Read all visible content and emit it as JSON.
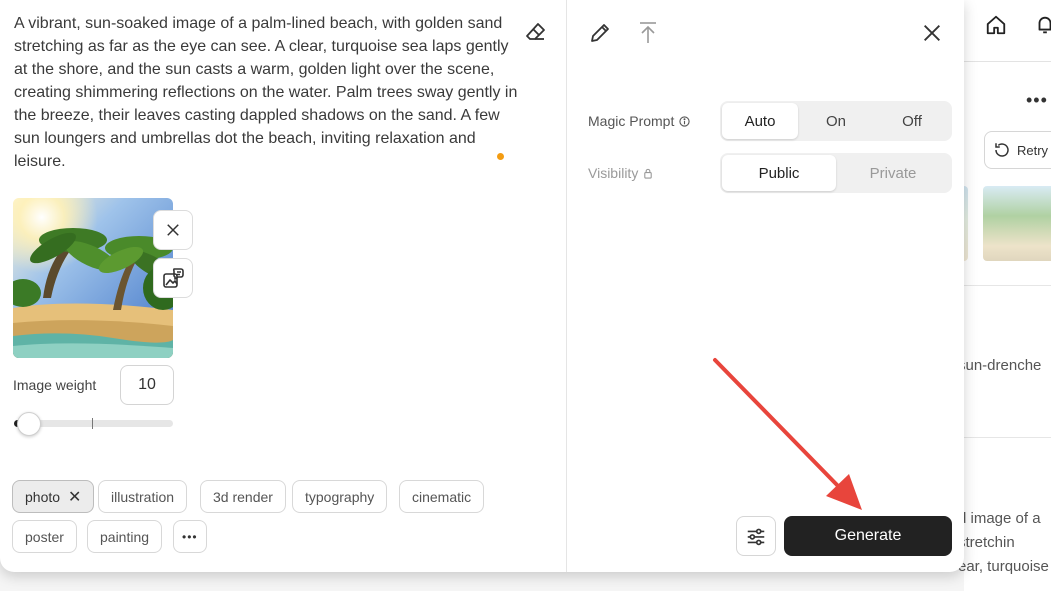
{
  "prompt": {
    "text": "A vibrant, sun-soaked image of a palm-lined beach, with golden sand stretching as far as the eye can see. A clear, turquoise sea laps gently at the shore, and the sun casts a warm, golden light over the scene, creating shimmering reflections on the water. Palm trees sway gently in the breeze, their leaves casting dappled shadows on the sand. A few sun loungers and umbrellas dot the beach, inviting relaxation and leisure."
  },
  "image_ref": {
    "weight_label": "Image weight",
    "weight_value": "10",
    "slider_fraction": 0.1
  },
  "styles": {
    "chips": [
      "photo",
      "illustration",
      "3d render",
      "typography",
      "cinematic",
      "poster",
      "painting"
    ],
    "active": "photo",
    "remove_glyph": "✕",
    "more_glyph": "•••"
  },
  "settings": {
    "magic_prompt": {
      "label": "Magic Prompt",
      "options": [
        "Auto",
        "On",
        "Off"
      ],
      "selected": "Auto"
    },
    "visibility": {
      "label": "Visibility",
      "options": [
        "Public",
        "Private"
      ],
      "selected": "Public"
    }
  },
  "actions": {
    "generate_label": "Generate"
  },
  "background": {
    "retry_label": "Retry",
    "snippet_1": "sun-drenche",
    "snippet_2": "d image of a",
    "snippet_3": "stretchin",
    "snippet_4": "ear, turquoise"
  },
  "colors": {
    "accent_dot": "#f39c12",
    "generate_bg": "#222222",
    "annotation_arrow": "#e8453c"
  }
}
